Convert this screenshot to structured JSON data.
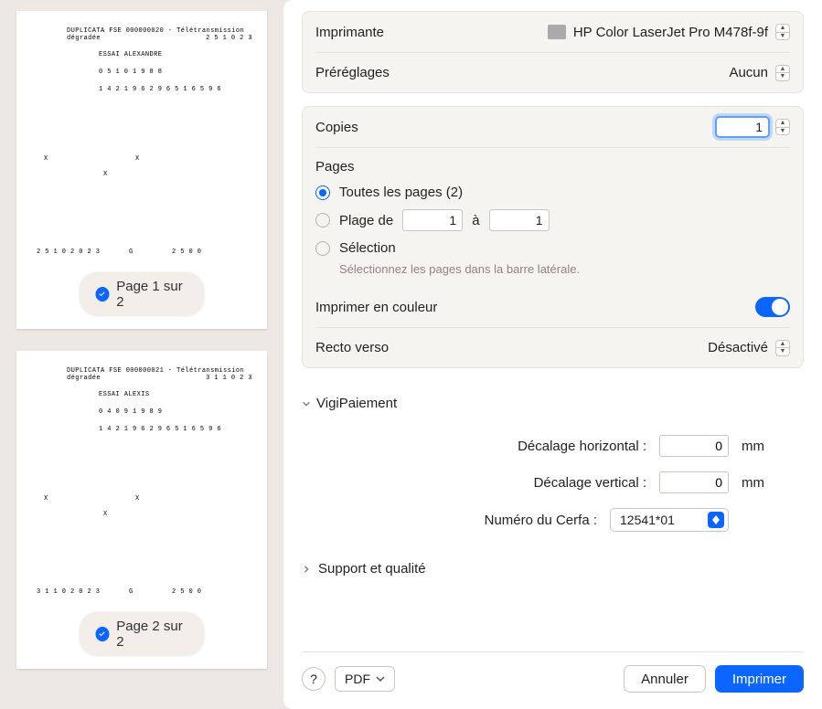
{
  "sidebar": {
    "pages": [
      {
        "badge": "Page 1 sur 2",
        "lines": [
          "DUPLICATA FSE 000000020 - Télétransmission dégradée",
          "2 5 1 0 2 3",
          "ESSAI ALEXANDRE",
          "0 5 1 0 1 9 8 8",
          "1 4 2 1 9 6 2 9 6 5 1 6 5   9 6",
          "X",
          "X",
          "X",
          "2 5 1 0 2 0 2 3",
          "G",
          "2 5 0 0",
          "2 5 0 0"
        ]
      },
      {
        "badge": "Page 2 sur 2",
        "lines": [
          "DUPLICATA FSE 000000021 - Télétransmission dégradée",
          "3 1 1 0 2 3",
          "ESSAI ALEXIS",
          "0 4 0 9 1 9 8 9",
          "1 4 2 1 9 6 2 9 6 5 1 6 5   9 6",
          "X",
          "X",
          "X",
          "3 1 1 0 2 0 2 3",
          "G",
          "2 5 0 0",
          "2 5 0 0"
        ]
      }
    ]
  },
  "panel": {
    "printer": {
      "label": "Imprimante",
      "value": "HP Color LaserJet Pro M478f-9f"
    },
    "presets": {
      "label": "Préréglages",
      "value": "Aucun"
    },
    "copies": {
      "label": "Copies",
      "value": "1"
    },
    "pages": {
      "label": "Pages",
      "all": "Toutes les pages (2)",
      "range_label": "Plage de",
      "range_from": "1",
      "range_sep": "à",
      "range_to": "1",
      "selection_label": "Sélection",
      "selection_help": "Sélectionnez les pages dans la barre latérale."
    },
    "color": {
      "label": "Imprimer en couleur"
    },
    "duplex": {
      "label": "Recto verso",
      "value": "Désactivé"
    },
    "vigi": {
      "title": "VigiPaiement",
      "h_offset_label": "Décalage horizontal :",
      "h_offset_value": "0",
      "v_offset_label": "Décalage vertical :",
      "v_offset_value": "0",
      "unit": "mm",
      "cerfa_label": "Numéro du Cerfa :",
      "cerfa_value": "12541*01"
    },
    "support_title": "Support et qualité"
  },
  "footer": {
    "help": "?",
    "pdf": "PDF",
    "cancel": "Annuler",
    "print": "Imprimer"
  }
}
